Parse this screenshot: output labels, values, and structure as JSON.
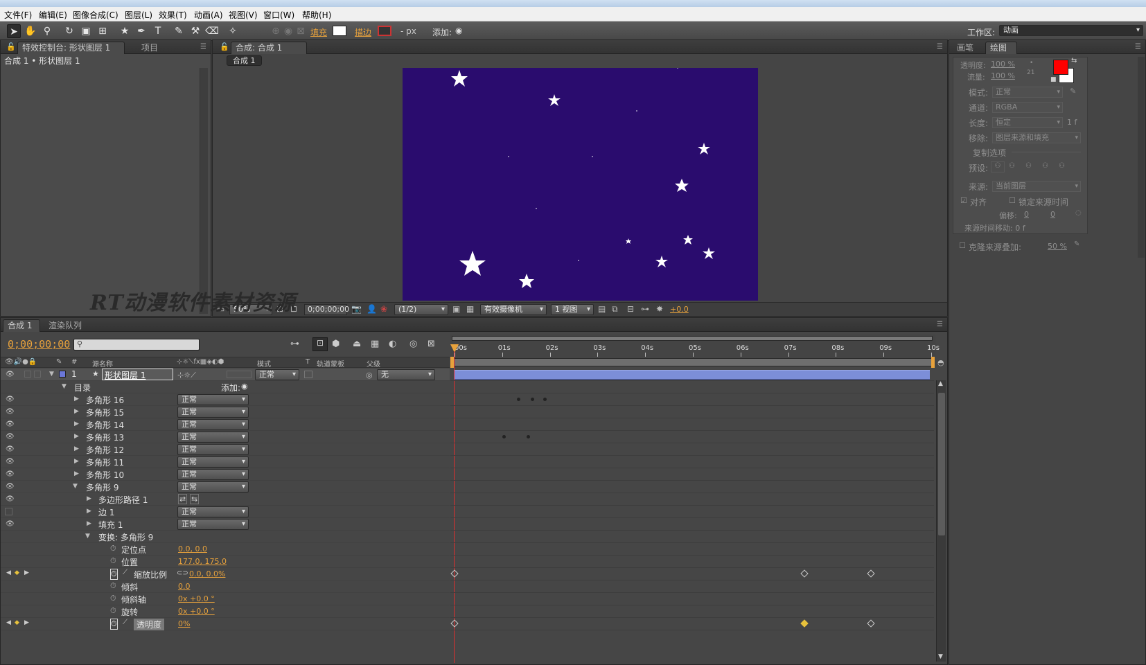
{
  "menu": [
    "文件(F)",
    "编辑(E)",
    "图像合成(C)",
    "图层(L)",
    "效果(T)",
    "动画(A)",
    "视图(V)",
    "窗口(W)",
    "帮助(H)"
  ],
  "toolbar": {
    "fill_label": "填充",
    "stroke_label": "描边",
    "px_label": "- px",
    "add_label": "添加:",
    "workspace_label": "工作区:",
    "workspace_value": "动画",
    "tools": [
      "selection-tool",
      "hand-tool",
      "zoom-tool",
      "rotate-tool",
      "camera-tool",
      "pan-behind-tool",
      "star-tool",
      "pen-tool",
      "type-tool",
      "brush-tool",
      "clone-stamp-tool",
      "eraser-tool",
      "puppet-tool"
    ]
  },
  "effects_panel": {
    "tab1": "特效控制台: 形状图层 1",
    "tab2": "项目",
    "header": "合成 1 • 形状图层 1"
  },
  "comp_panel": {
    "tab": "合成: 合成 1",
    "subtab": "合成 1",
    "zoom": "50%",
    "timecode": "0;00;00;00",
    "resolution": "(1/2)",
    "camera": "有效摄像机",
    "views": "1 视图",
    "exposure": "+0.0",
    "bg_color": "#2a0c6e"
  },
  "watermark": "RT动漫软件素材资源",
  "paint_panel": {
    "tab1": "画笔",
    "tab2": "绘图",
    "opacity_label": "透明度:",
    "opacity_value": "100 %",
    "flow_label": "流量:",
    "flow_value": "100 %",
    "mode_label": "模式:",
    "mode_value": "正常",
    "channel_label": "通道:",
    "channel_value": "RGBA",
    "duration_label": "长度:",
    "duration_value": "恒定",
    "duration_extra": "1 f",
    "erase_label": "移除:",
    "erase_value": "图层来源和填充",
    "clone_options": "复制选项",
    "preset_label": "预设:",
    "source_label": "来源:",
    "source_value": "当前图层",
    "aligned": "对齐",
    "lock_time": "锁定来源时间",
    "offset_label": "偏移:",
    "offset_x": "0",
    "offset_y": "0",
    "source_time": "来源时间移动: 0 f",
    "clone_overlay": "克隆来源叠加:",
    "clone_overlay_value": "50 %",
    "foreground_color": "#ff0000",
    "background_color": "#ffffff",
    "brush_size": "21"
  },
  "timeline": {
    "tab1": "合成 1",
    "tab2": "渲染队列",
    "timecode": "0;00;00;00",
    "col_source": "源名称",
    "col_mode": "模式",
    "col_t": "T",
    "col_trkmat": "轨道蒙板",
    "col_parent": "父级",
    "ruler": [
      "00s",
      "01s",
      "02s",
      "03s",
      "04s",
      "05s",
      "06s",
      "07s",
      "08s",
      "09s",
      "10s"
    ],
    "layer": {
      "num": "1",
      "name": "形状图层 1",
      "mode": "正常",
      "parent": "无"
    },
    "contents_label": "目录",
    "add_label": "添加:",
    "polygons": [
      {
        "name": "多角形 16",
        "mode": "正常"
      },
      {
        "name": "多角形 15",
        "mode": "正常"
      },
      {
        "name": "多角形 14",
        "mode": "正常"
      },
      {
        "name": "多角形 13",
        "mode": "正常"
      },
      {
        "name": "多角形 12",
        "mode": "正常"
      },
      {
        "name": "多角形 11",
        "mode": "正常"
      },
      {
        "name": "多角形 10",
        "mode": "正常"
      },
      {
        "name": "多角形 9",
        "mode": "正常"
      }
    ],
    "poly9_children": [
      {
        "name": "多边形路径 1"
      },
      {
        "name": "边 1",
        "mode": "正常"
      },
      {
        "name": "填充 1",
        "mode": "正常"
      }
    ],
    "transform_label": "变换: 多角形 9",
    "props": [
      {
        "name": "定位点",
        "value": "0.0, 0.0"
      },
      {
        "name": "位置",
        "value": "177.0, 175.0"
      },
      {
        "name": "缩放比例",
        "value": "0.0, 0.0%"
      },
      {
        "name": "倾斜",
        "value": "0.0"
      },
      {
        "name": "倾斜轴",
        "value": "0x +0.0 °"
      },
      {
        "name": "旋转",
        "value": "0x +0.0 °"
      },
      {
        "name": "透明度",
        "value": "0%"
      }
    ]
  }
}
